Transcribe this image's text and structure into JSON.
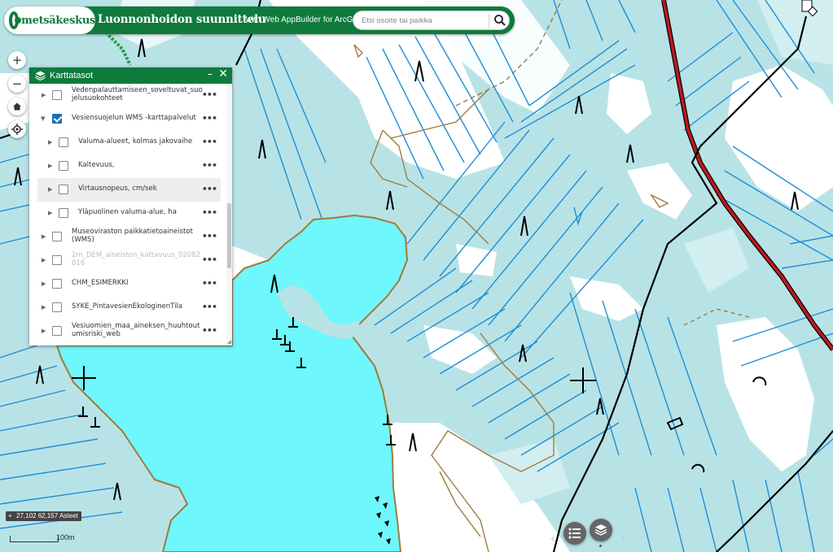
{
  "header": {
    "logo_text": "metsäkeskus",
    "title": "Luonnonhoidon suunnittelu",
    "subtitle": "with Web AppBuilder for ArcGIS",
    "search_placeholder": "Etsi osoite tai paikka",
    "search_icon": "search-icon"
  },
  "map_controls": {
    "zoom_in": "+",
    "zoom_out": "−",
    "home_icon": "home-icon",
    "locate_icon": "locate-icon"
  },
  "layer_panel": {
    "title": "Karttatasot",
    "minimize": "–",
    "close": "✕",
    "layers": [
      {
        "name": "Vedenpalauttamiseen_soveltuvat_suojelusuokohteet",
        "line1": "Vedenpalauttamiseen_soveltuvat_suo",
        "line2": "jelusuokohteet",
        "checked": false,
        "expanded": false,
        "level": 0
      },
      {
        "name": "Vesiensuojelun WMS -karttapalvelut",
        "line1": "Vesiensuojelun WMS -karttapalvelut",
        "checked": true,
        "expanded": true,
        "level": 0
      },
      {
        "name": "Valuma-alueet, kolmas jakovaihe",
        "line1": "Valuma-alueet, kolmas jakovaihe",
        "checked": false,
        "expanded": false,
        "level": 1
      },
      {
        "name": "Kaltevuus,",
        "line1": "Kaltevuus,",
        "checked": false,
        "expanded": false,
        "level": 1
      },
      {
        "name": "Virtausnopeus, cm/sek",
        "line1": "Virtausnopeus, cm/sek",
        "checked": false,
        "expanded": false,
        "level": 1,
        "highlighted": true
      },
      {
        "name": "Yläpuolinen valuma-alue, ha",
        "line1": "Yläpuolinen valuma-alue, ha",
        "checked": false,
        "expanded": false,
        "level": 1
      },
      {
        "name": "Museoviraston paikkatietoaineistot (WMS)",
        "line1": "Museoviraston paikkatietoaineistot",
        "line2": "(WMS)",
        "checked": false,
        "expanded": false,
        "level": 0
      },
      {
        "name": "2m_DEM_aineiston_kattavuus_02082016",
        "line1": "2m_DEM_aineiston_kattavuus_02082",
        "line2": "016",
        "checked": false,
        "expanded": false,
        "level": 0,
        "dimmed": true
      },
      {
        "name": "CHM_ESIMERKKI",
        "line1": "CHM_ESIMERKKI",
        "checked": false,
        "expanded": false,
        "level": 0
      },
      {
        "name": "SYKE_PintavesienEkologinenTila",
        "line1": "SYKE_PintavesienEkologinenTila",
        "checked": false,
        "expanded": false,
        "level": 0
      },
      {
        "name": "Vesiuomien_maa_aineksen_huuhtoutumisriski_web",
        "line1": "Vesiuomien_maa_aineksen_huuhtout",
        "line2": "umisriski_web",
        "checked": false,
        "expanded": false,
        "level": 0
      }
    ],
    "options_label": "•••"
  },
  "status": {
    "coordinates": "27,102 62,157 Asteet",
    "scale_label": "100m"
  },
  "bottom_toolbar": {
    "prev_arrow": "‹",
    "next_arrow": "›",
    "legend_icon": "legend-list-icon",
    "layers_icon": "layers-icon"
  },
  "colors": {
    "brand_green": "#0f7a3c",
    "lake": "#6ef7fc",
    "map_bg": "#b8e3e6",
    "open_land": "#ffffff",
    "contour": "#a07b3c",
    "ditch": "#1e8fd6",
    "road_red": "#c0191e",
    "checkbox_blue": "#1b6fb6"
  }
}
